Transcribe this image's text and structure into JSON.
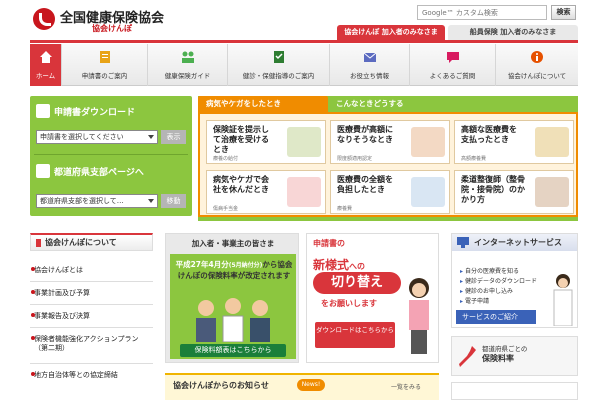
{
  "header": {
    "org_name": "全国健康保険協会",
    "org_sub": "協会けんぽ",
    "search_placeholder": "Google™ カスタム検索",
    "search_button": "検索",
    "user_tab_members": "協会けんぽ 加入者のみなさま",
    "user_tab_seamen": "船員保険 加入者のみなさま",
    "brand_color": "#c8161d"
  },
  "global_nav": [
    {
      "label": "ホーム",
      "icon": "house-icon"
    },
    {
      "label": "申請書のご案内",
      "icon": "document-icon"
    },
    {
      "label": "健康保険ガイド",
      "icon": "people-icon"
    },
    {
      "label": "健診・保健指導のご案内",
      "icon": "checklist-icon"
    },
    {
      "label": "お役立ち情報",
      "icon": "mail-icon"
    },
    {
      "label": "よくあるご質問",
      "icon": "speech-icon"
    },
    {
      "label": "協会けんぽについて",
      "icon": "info-icon"
    }
  ],
  "left_nav": {
    "download_title": "申請書ダウンロード",
    "download_select": "申請書を選択してください",
    "download_button": "表示",
    "branch_title": "都道府県支部ページへ",
    "branch_select": "都道府県支部を選択して…",
    "branch_button": "移動"
  },
  "content_tabs": {
    "tab_active": "病気やケガをしたとき",
    "tab_other": "こんなときどうする"
  },
  "cards": [
    {
      "title": "保険証を提示して治療を受けるとき",
      "sub": "療養の給付"
    },
    {
      "title": "医療費が高額になりそうなとき",
      "sub": "限度額適用認定"
    },
    {
      "title": "高額な医療費を支払ったとき",
      "sub": "高額療養費"
    },
    {
      "title": "病気やケガで会社を休んだとき",
      "sub": "傷病手当金"
    },
    {
      "title": "医療費の全額を負担したとき",
      "sub": "療養費"
    },
    {
      "title": "柔道整復師（整骨院・接骨院）のかかり方",
      "sub": ""
    }
  ],
  "about": {
    "title": "協会けんぽについて",
    "items": [
      "協会けんぽとは",
      "事業計画及び予算",
      "事業報告及び決算",
      "保険者機能強化アクションプラン（第二期）",
      "地方自治体等との協定締結"
    ]
  },
  "middle_promo": {
    "header": "加入者・事業主の皆さま",
    "text_1": "平成27年4月分",
    "text_2": "(5月納付分)",
    "text_3": "から協会けんぽの保険料率が改定されます",
    "button": "保険料額表はこちらから"
  },
  "form_promo": {
    "header": "申請書の",
    "text_new": "新様式",
    "text_he": "への",
    "text_kae": "切り替え",
    "text_wo": "をお願いします",
    "button": "ダウンロードはこちらから"
  },
  "news": {
    "title": "協会けんぽからのお知らせ",
    "badge": "News!",
    "more": "一覧をみる"
  },
  "internet_service": {
    "title": "インターネットサービス",
    "items": [
      "自分の医療費を知る",
      "健診データのダウンロード",
      "健診のお申し込み",
      "電子申請"
    ],
    "footer": "サービスのご紹介"
  },
  "branch_box": {
    "line_1": "都道府県ごとの",
    "line_2": "保険料率"
  }
}
